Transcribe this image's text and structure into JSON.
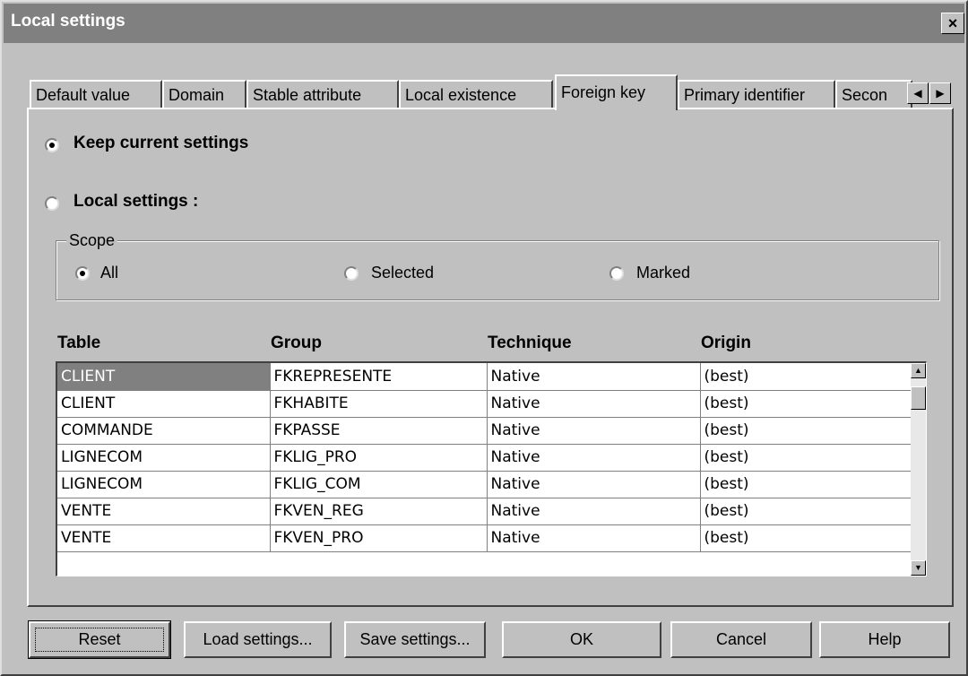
{
  "window": {
    "title": "Local settings",
    "close_label": "×"
  },
  "tabs": [
    {
      "label": "Default value"
    },
    {
      "label": "Domain"
    },
    {
      "label": "Stable attribute"
    },
    {
      "label": "Local existence"
    },
    {
      "label": "Foreign key",
      "active": true
    },
    {
      "label": "Primary identifier"
    },
    {
      "label": "Secon"
    }
  ],
  "tab_scroll": {
    "left": "◀",
    "right": "▶"
  },
  "options": {
    "keep_current": "Keep current settings",
    "local_settings": "Local settings :",
    "selected": "keep_current"
  },
  "scope": {
    "label": "Scope",
    "all": "All",
    "selected": "Selected",
    "marked": "Marked",
    "value": "all"
  },
  "table": {
    "headers": [
      "Table",
      "Group",
      "Technique",
      "Origin"
    ],
    "rows": [
      [
        "CLIENT",
        "FKREPRESENTE",
        "Native",
        "(best)"
      ],
      [
        "CLIENT",
        "FKHABITE",
        "Native",
        "(best)"
      ],
      [
        "COMMANDE",
        "FKPASSE",
        "Native",
        "(best)"
      ],
      [
        "LIGNECOM",
        "FKLIG_PRO",
        "Native",
        "(best)"
      ],
      [
        "LIGNECOM",
        "FKLIG_COM",
        "Native",
        "(best)"
      ],
      [
        "VENTE",
        "FKVEN_REG",
        "Native",
        "(best)"
      ],
      [
        "VENTE",
        "FKVEN_PRO",
        "Native",
        "(best)"
      ]
    ],
    "scroll_up": "▲",
    "scroll_down": "▼"
  },
  "buttons": {
    "reset": "Reset",
    "load": "Load settings...",
    "save": "Save settings...",
    "ok": "OK",
    "cancel": "Cancel",
    "help": "Help"
  }
}
